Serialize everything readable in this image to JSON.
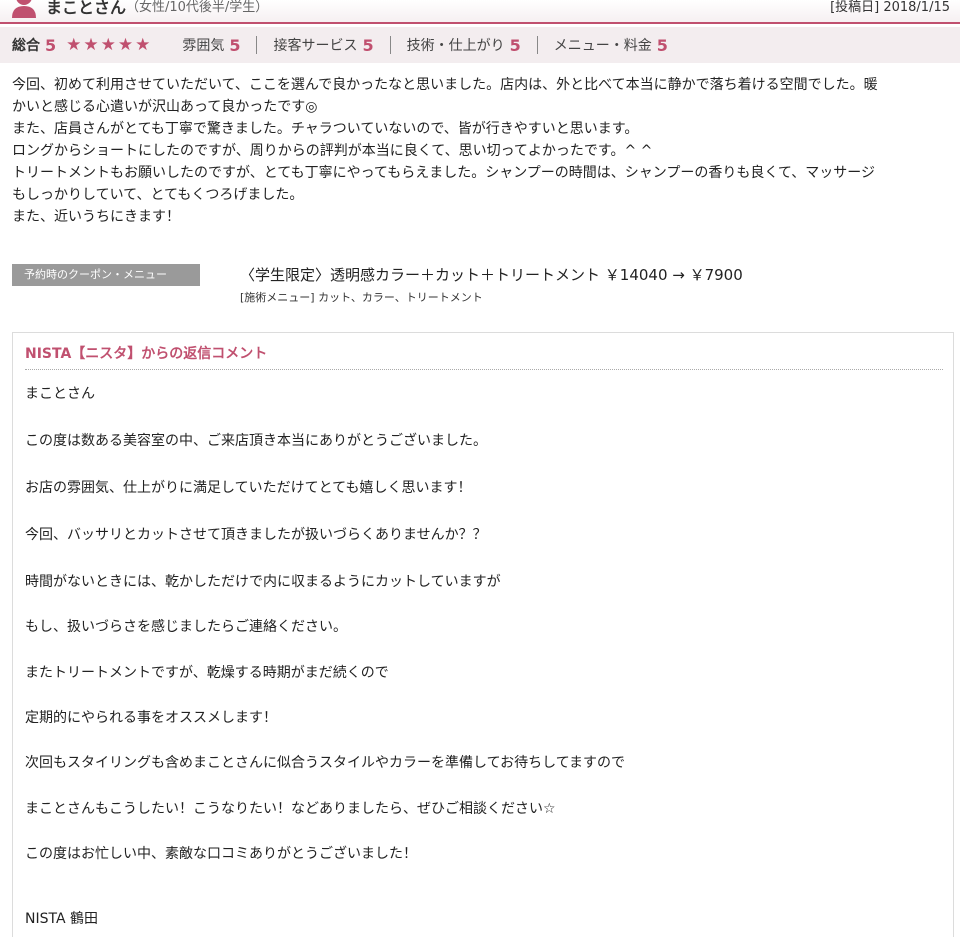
{
  "reviewer": {
    "name": "まことさん",
    "attributes": "（女性/10代後半/学生）",
    "visit_date": "[投稿日] 2018/1/15"
  },
  "ratings": {
    "overall_label": "総合",
    "overall_value": "5",
    "stars": "★★★★★",
    "items": [
      {
        "label": "雰囲気",
        "value": "5"
      },
      {
        "label": "接客サービス",
        "value": "5"
      },
      {
        "label": "技術・仕上がり",
        "value": "5"
      },
      {
        "label": "メニュー・料金",
        "value": "5"
      }
    ]
  },
  "review": {
    "lines": [
      "今回、初めて利用させていただいて、ここを選んで良かったなと思いました。店内は、外と比べて本当に静かで落ち着ける空間でした。暖",
      "かいと感じる心遣いが沢山あって良かったです◎",
      "また、店員さんがとても丁寧で驚きました。チャラついていないので、皆が行きやすいと思います。",
      "ロングからショートにしたのですが、周りからの評判が本当に良くて、思い切ってよかったです。^ ^",
      "トリートメントもお願いしたのですが、とても丁寧にやってもらえました。シャンプーの時間は、シャンプーの香りも良くて、マッサージ",
      "もしっかりしていて、とてもくつろげました。",
      "また、近いうちにきます！"
    ]
  },
  "coupon": {
    "badge": "予約時のクーポン・メニュー",
    "text": "〈学生限定〉透明感カラー＋カット＋トリートメント ￥14040 → ￥7900",
    "menu": "[施術メニュー] カット、カラー、トリートメント"
  },
  "reply": {
    "title": "NISTA【ニスタ】からの返信コメント",
    "lines": [
      "まことさん",
      "この度は数ある美容室の中、ご来店頂き本当にありがとうございました。",
      "お店の雰囲気、仕上がりに満足していただけてとても嬉しく思います！",
      "今回、バッサリとカットさせて頂きましたが扱いづらくありませんか？？",
      "時間がないときには、乾かしただけで内に収まるようにカットしていますが",
      "もし、扱いづらさを感じましたらご連絡ください。",
      "またトリートメントですが、乾燥する時期がまだ続くので",
      "定期的にやられる事をオススメします！",
      "次回もスタイリングも含めまことさんに似合うスタイルやカラーを準備してお待ちしてますので",
      "まことさんもこうしたい！こうなりたい！などありましたら、ぜひご相談ください☆",
      "この度はお忙しい中、素敵な口コミありがとうございました！",
      "NISTA 鶴田"
    ]
  },
  "colors": {
    "accent": "#c0506f",
    "rating_bg": "#f3edef",
    "badge_bg": "#9a9a9a"
  }
}
